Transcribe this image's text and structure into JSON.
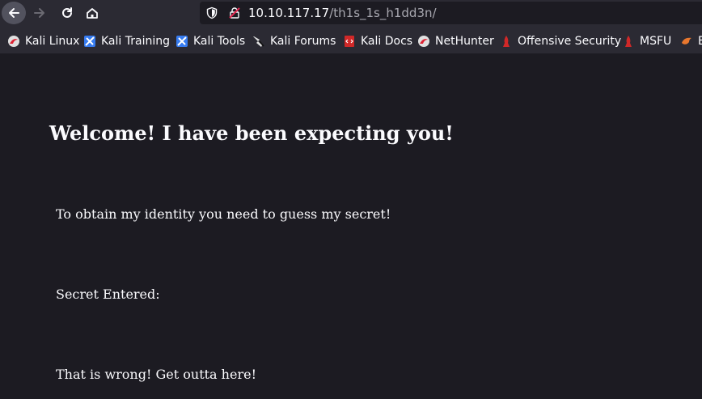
{
  "browser": {
    "url_host": "10.10.117.17",
    "url_path": "/th1s_1s_h1dd3n/"
  },
  "bookmarks": [
    {
      "label": "Kali Linux",
      "icon": "kali-dragon-icon"
    },
    {
      "label": "Kali Training",
      "icon": "kali-training-icon"
    },
    {
      "label": "Kali Tools",
      "icon": "kali-tools-icon"
    },
    {
      "label": "Kali Forums",
      "icon": "kali-forums-icon"
    },
    {
      "label": "Kali Docs",
      "icon": "kali-docs-icon"
    },
    {
      "label": "NetHunter",
      "icon": "nethunter-icon"
    },
    {
      "label": "Offensive Security",
      "icon": "offsec-icon"
    },
    {
      "label": "MSFU",
      "icon": "msfu-icon"
    },
    {
      "label": "E",
      "icon": "exploit-db-icon"
    }
  ],
  "page": {
    "heading": "Welcome! I have been expecting you!",
    "intro": "To obtain my identity you need to guess my secret!",
    "secret_label": "Secret Entered:",
    "result": "That is wrong! Get outta here!"
  },
  "colors": {
    "toolbar_bg": "#2b2a33",
    "page_bg": "#1c1b22",
    "text": "#fbfbfe"
  }
}
